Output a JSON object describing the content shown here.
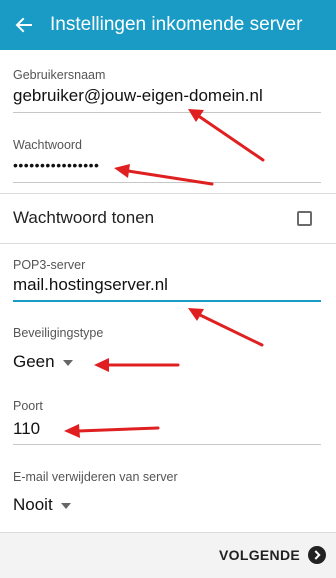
{
  "header": {
    "title": "Instellingen inkomende server",
    "background": "#1a9bc6"
  },
  "fields": {
    "username": {
      "label": "Gebruikersnaam",
      "value": "gebruiker@jouw-eigen-domein.nl"
    },
    "password": {
      "label": "Wachtwoord",
      "value": "••••••••••••••••"
    },
    "show_password": {
      "label": "Wachtwoord tonen",
      "checked": false
    },
    "server": {
      "label": "POP3-server",
      "value": "mail.hostingserver.nl"
    },
    "security": {
      "label": "Beveiligingstype",
      "value": "Geen"
    },
    "port": {
      "label": "Poort",
      "value": "110"
    },
    "delete_from_server": {
      "label": "E-mail verwijderen van server",
      "value": "Nooit"
    }
  },
  "footer": {
    "next_label": "VOLGENDE"
  },
  "annotation": {
    "arrow_color": "#e02020"
  }
}
